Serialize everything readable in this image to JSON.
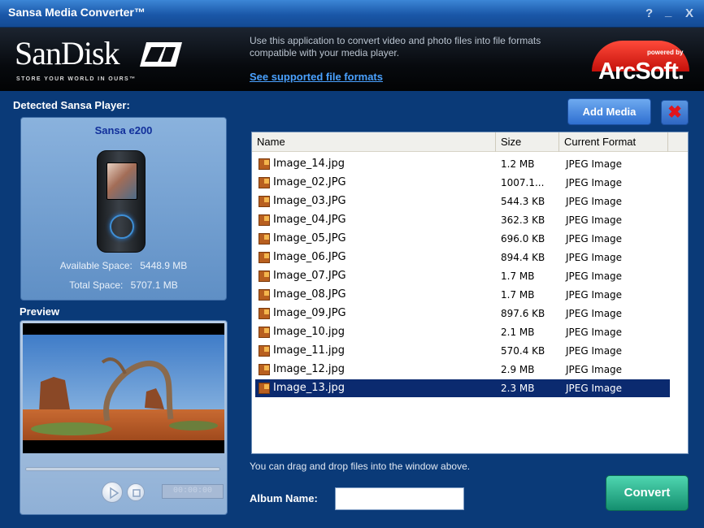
{
  "window": {
    "title": "Sansa Media Converter™",
    "help_label": "?",
    "minimize_label": "_",
    "close_label": "X"
  },
  "banner": {
    "logo_text": "SanDisk",
    "tagline": "STORE YOUR WORLD IN OURS™",
    "description": "Use this application to convert video and photo files into file formats compatible with your media player.",
    "link_text": "See supported file formats",
    "powered_by": "powered by",
    "partner": "ArcSoft."
  },
  "player": {
    "section_label": "Detected Sansa Player:",
    "name": "Sansa e200",
    "available_label": "Available Space:",
    "available_value": "5448.9 MB",
    "total_label": "Total Space:",
    "total_value": "5707.1 MB"
  },
  "preview": {
    "label": "Preview",
    "time": "00:00:00"
  },
  "toolbar": {
    "add_media": "Add Media"
  },
  "file_list": {
    "columns": [
      "Name",
      "Size",
      "Current Format"
    ],
    "rows": [
      {
        "name": "Image_14.jpg",
        "size": "1.2 MB",
        "format": "JPEG Image"
      },
      {
        "name": "Image_02.JPG",
        "size": "1007.1...",
        "format": "JPEG Image"
      },
      {
        "name": "Image_03.JPG",
        "size": "544.3 KB",
        "format": "JPEG Image"
      },
      {
        "name": "Image_04.JPG",
        "size": "362.3 KB",
        "format": "JPEG Image"
      },
      {
        "name": "Image_05.JPG",
        "size": "696.0 KB",
        "format": "JPEG Image"
      },
      {
        "name": "Image_06.JPG",
        "size": "894.4 KB",
        "format": "JPEG Image"
      },
      {
        "name": "Image_07.JPG",
        "size": "1.7 MB",
        "format": "JPEG Image"
      },
      {
        "name": "Image_08.JPG",
        "size": "1.7 MB",
        "format": "JPEG Image"
      },
      {
        "name": "Image_09.JPG",
        "size": "897.6 KB",
        "format": "JPEG Image"
      },
      {
        "name": "Image_10.jpg",
        "size": "2.1 MB",
        "format": "JPEG Image"
      },
      {
        "name": "Image_11.jpg",
        "size": "570.4 KB",
        "format": "JPEG Image"
      },
      {
        "name": "Image_12.jpg",
        "size": "2.9 MB",
        "format": "JPEG Image"
      },
      {
        "name": "Image_13.jpg",
        "size": "2.3 MB",
        "format": "JPEG Image"
      }
    ],
    "selected_index": 12
  },
  "footer": {
    "drag_hint": "You can drag and drop files into the window above.",
    "album_label": "Album Name:",
    "album_value": "",
    "convert": "Convert"
  },
  "colors": {
    "background": "#0a3a78",
    "selection": "#0b2a6f",
    "convert_button": "#148f6f",
    "add_media_button": "#2f6fd0"
  }
}
